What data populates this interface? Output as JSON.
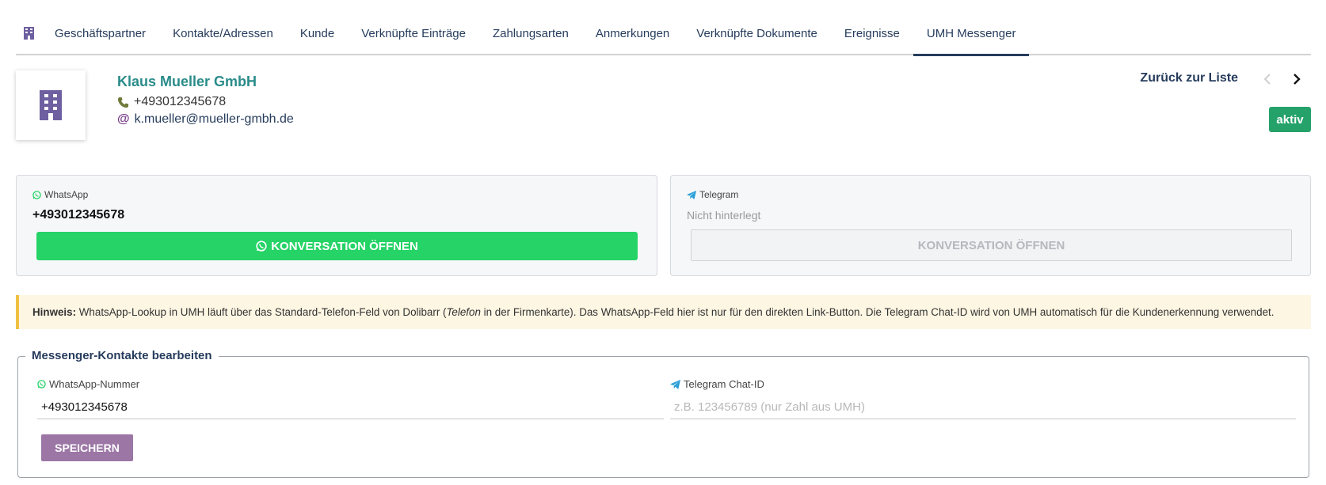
{
  "tabs": [
    {
      "label": "Geschäftspartner"
    },
    {
      "label": "Kontakte/Adressen"
    },
    {
      "label": "Kunde"
    },
    {
      "label": "Verknüpfte Einträge"
    },
    {
      "label": "Zahlungsarten"
    },
    {
      "label": "Anmerkungen"
    },
    {
      "label": "Verknüpfte Dokumente"
    },
    {
      "label": "Ereignisse"
    },
    {
      "label": "UMH Messenger"
    }
  ],
  "company": {
    "name": "Klaus Mueller GmbH",
    "phone": "+493012345678",
    "email": "k.mueller@mueller-gmbh.de"
  },
  "nav": {
    "back_label": "Zurück zur Liste",
    "status": "aktiv"
  },
  "whatsapp_card": {
    "label": "WhatsApp",
    "value": "+493012345678",
    "button": "KONVERSATION ÖFFNEN"
  },
  "telegram_card": {
    "label": "Telegram",
    "empty_text": "Nicht hinterlegt",
    "button": "KONVERSATION ÖFFNEN"
  },
  "hint": {
    "title": "Hinweis:",
    "text_before": " WhatsApp-Lookup in UMH läuft über das Standard-Telefon-Feld von Dolibarr (",
    "italic": "Telefon",
    "text_after": " in der Firmenkarte). Das WhatsApp-Feld hier ist nur für den direkten Link-Button. Die Telegram Chat-ID wird von UMH automatisch für die Kundenerkennung verwendet."
  },
  "form": {
    "legend": "Messenger-Kontakte bearbeiten",
    "whatsapp_label": "WhatsApp-Nummer",
    "whatsapp_value": "+493012345678",
    "telegram_label": "Telegram Chat-ID",
    "telegram_placeholder": "z.B. 123456789 (nur Zahl aus UMH)",
    "save_button": "SPEICHERN"
  },
  "colors": {
    "accent": "#263c5c",
    "company_name": "#2a8c8a",
    "whatsapp_green": "#25d366",
    "status_green": "#25a26a",
    "save_purple": "#9c77a6",
    "hint_border": "#f0c040"
  },
  "icons": {
    "home_tab": "building-icon",
    "logo": "building-icon",
    "phone": "phone-icon",
    "email": "at-icon",
    "whatsapp": "whatsapp-icon",
    "telegram": "telegram-icon",
    "prev": "chevron-left-icon",
    "next": "chevron-right-icon"
  }
}
